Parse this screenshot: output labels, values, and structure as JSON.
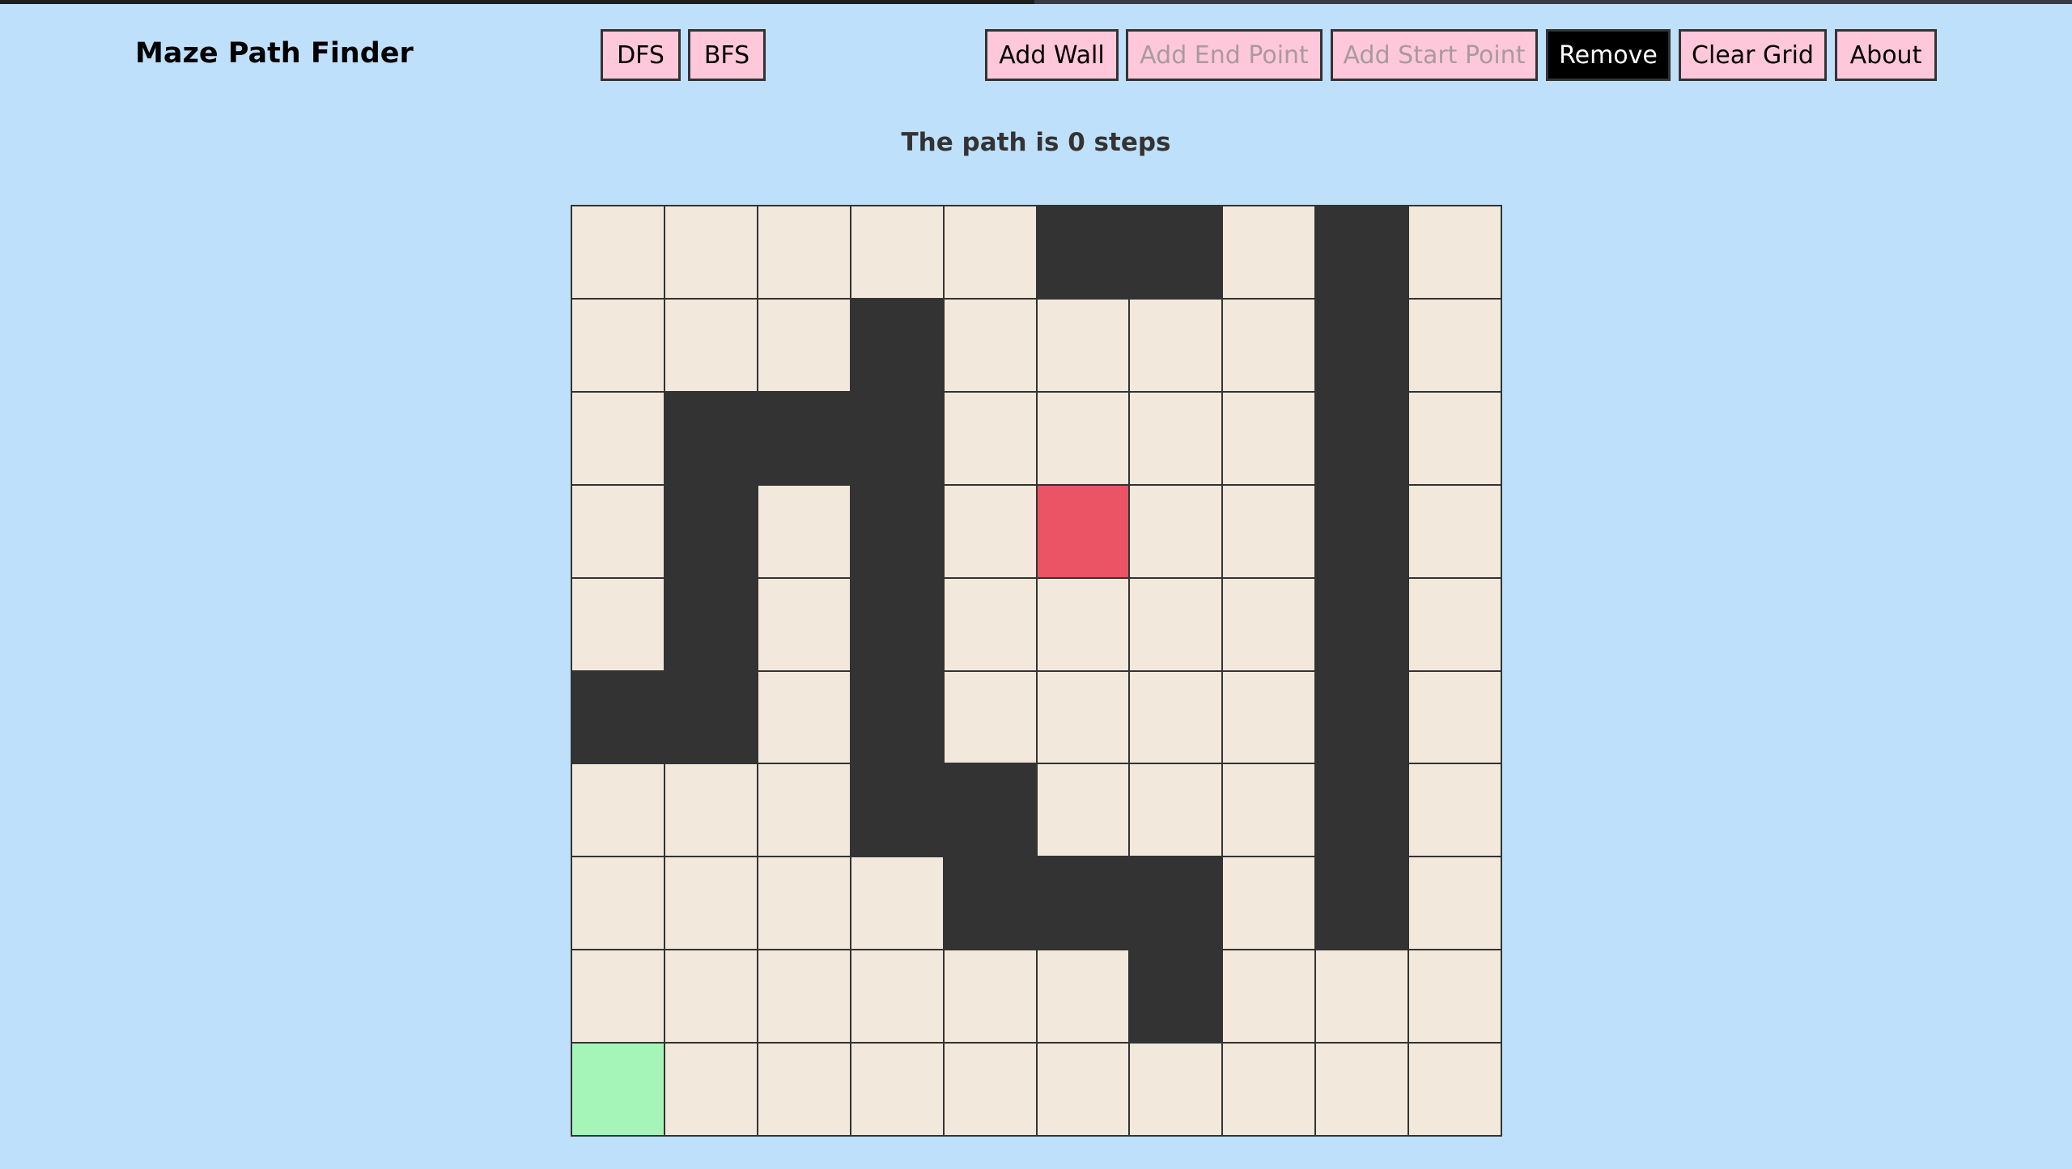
{
  "header": {
    "title": "Maze Path Finder"
  },
  "algorithms": [
    {
      "label": "DFS"
    },
    {
      "label": "BFS"
    }
  ],
  "tools": [
    {
      "label": "Add Wall",
      "state": "normal"
    },
    {
      "label": "Add End Point",
      "state": "disabled"
    },
    {
      "label": "Add Start Point",
      "state": "disabled"
    },
    {
      "label": "Remove",
      "state": "active"
    },
    {
      "label": "Clear Grid",
      "state": "normal"
    },
    {
      "label": "About",
      "state": "normal"
    }
  ],
  "status": "The path is 0 steps",
  "colors": {
    "background": "#bfe0fb",
    "button": "#ffc8da",
    "wall": "#333333",
    "empty": "#f2e8dc",
    "start": "#a5f5b8",
    "end": "#ea5465"
  },
  "grid": {
    "legend": {
      "#": "wall",
      ".": "empty",
      "S": "start",
      "E": "end"
    },
    "rows": [
      ".....##.#.",
      "...#....#.",
      ".###....#.",
      ".#.#.E..#.",
      ".#.#....#.",
      "##.#....#.",
      "...##...#.",
      "....###.#.",
      "......#...",
      "S........."
    ]
  }
}
